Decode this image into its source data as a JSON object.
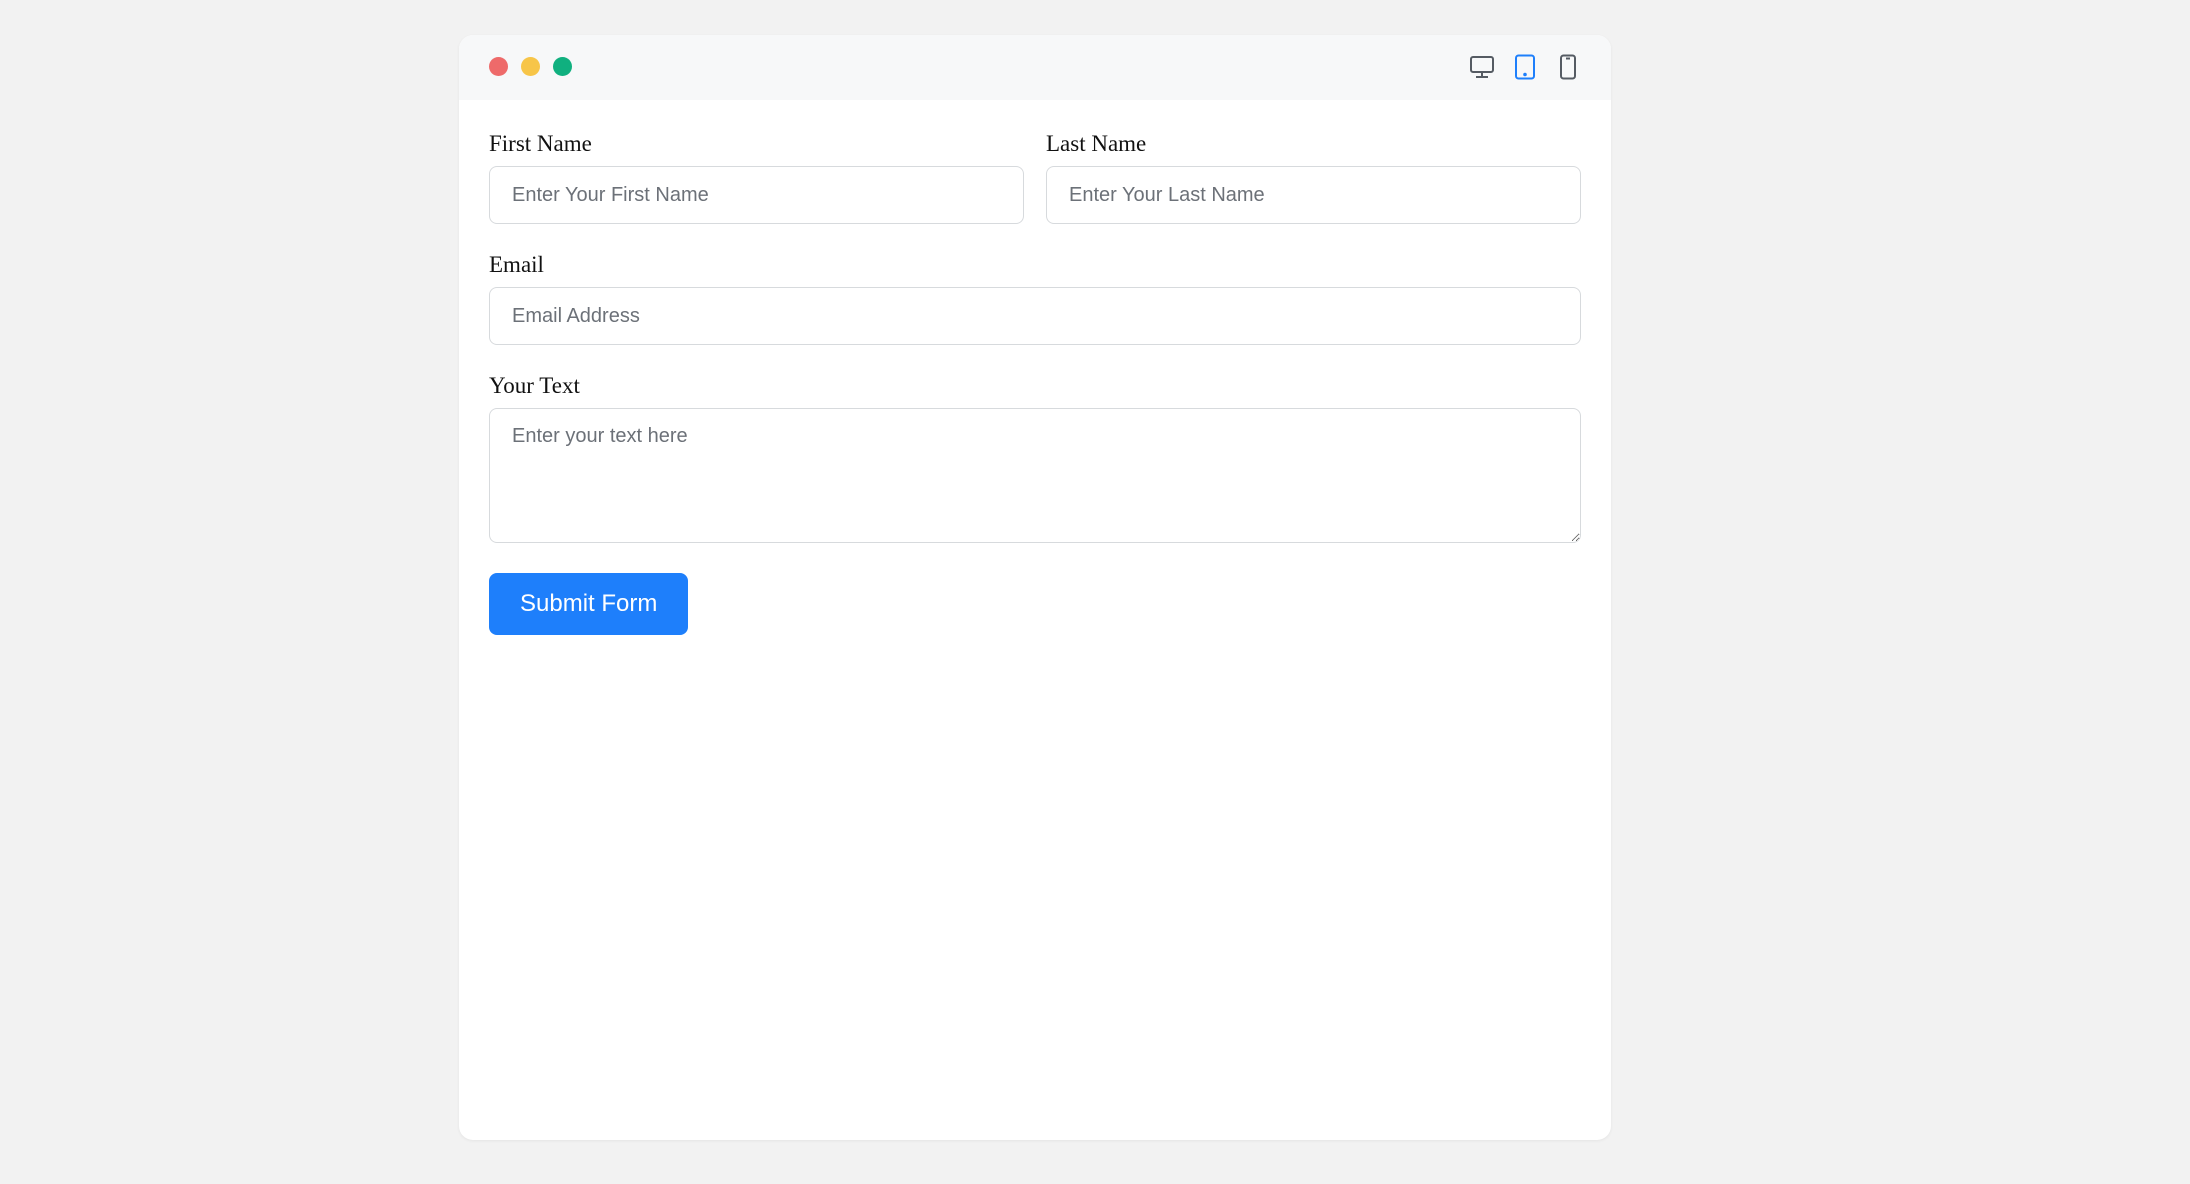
{
  "window": {
    "controls": [
      {
        "name": "close-dot",
        "color": "#ee6a6a"
      },
      {
        "name": "minimize-dot",
        "color": "#f7c548"
      },
      {
        "name": "maximize-dot",
        "color": "#10b07f"
      }
    ],
    "device_toggle": [
      {
        "icon": "desktop-icon",
        "active": false,
        "color": "#555b63"
      },
      {
        "icon": "tablet-icon",
        "active": true,
        "color": "#1e7ffb"
      },
      {
        "icon": "mobile-icon",
        "active": false,
        "color": "#555b63"
      }
    ]
  },
  "form": {
    "first_name": {
      "label": "First Name",
      "placeholder": "Enter Your First Name",
      "value": ""
    },
    "last_name": {
      "label": "Last Name",
      "placeholder": "Enter Your Last Name",
      "value": ""
    },
    "email": {
      "label": "Email",
      "placeholder": "Email Address",
      "value": ""
    },
    "your_text": {
      "label": "Your Text",
      "placeholder": "Enter your text here",
      "value": ""
    },
    "submit_label": "Submit Form"
  },
  "colors": {
    "accent": "#1e7ffb",
    "page_bg": "#f2f2f2",
    "titlebar_bg": "#f7f8f9",
    "input_border": "#d7dadd"
  }
}
